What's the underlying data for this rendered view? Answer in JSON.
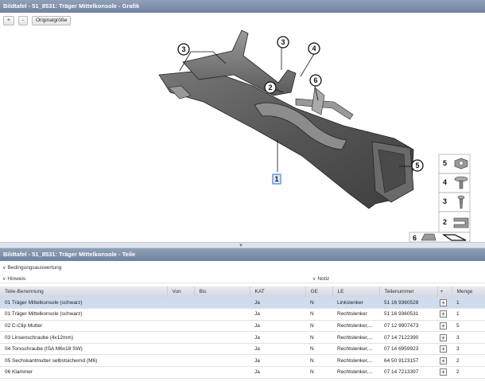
{
  "graphic_panel": {
    "title": "Bildtafel - 51_8531: Träger Mittelkonsole - Grafik",
    "toolbar": {
      "zoom_in": "+",
      "zoom_out": "-",
      "original_size": "Originalgröße"
    },
    "callouts": [
      "1",
      "2",
      "3",
      "3",
      "4",
      "6",
      "5"
    ],
    "legend": [
      "5",
      "4",
      "3",
      "2",
      "6"
    ]
  },
  "parts_panel": {
    "title": "Bildtafel - 51_8531: Träger Mittelkonsole - Teile",
    "filter_condition": "Bedingungsauswertung",
    "filter_hint": "Hinweis",
    "filter_note": "Notiz",
    "columns": [
      "Teile-Benennung",
      "Von",
      "Bis",
      "KAT",
      "GE",
      "LE",
      "Teilenummer",
      "+",
      "Menge"
    ],
    "rows": [
      {
        "name": "01 Träger Mittelkonsole (schwarz)",
        "von": "",
        "bis": "",
        "kat": "Ja",
        "ge": "N",
        "le": "Linkslenker",
        "part": "51 16 9360528",
        "qty": "1",
        "selected": true
      },
      {
        "name": "01 Träger Mittelkonsole (schwarz)",
        "von": "",
        "bis": "",
        "kat": "Ja",
        "ge": "N",
        "le": "Rechtslenker",
        "part": "51 16 9360531",
        "qty": "1",
        "selected": false
      },
      {
        "name": "02 C-Clip Mutter",
        "von": "",
        "bis": "",
        "kat": "Ja",
        "ge": "N",
        "le": "Rechtslenker,...",
        "part": "07 12 9907473",
        "qty": "5",
        "selected": false
      },
      {
        "name": "03 Linsenschraube (4x12mm)",
        "von": "",
        "bis": "",
        "kat": "Ja",
        "ge": "N",
        "le": "Rechtslenker,...",
        "part": "07 14 7122390",
        "qty": "3",
        "selected": false
      },
      {
        "name": "04 Torxschraube (ISA M6x18 SW)",
        "von": "",
        "bis": "",
        "kat": "Ja",
        "ge": "N",
        "le": "Rechtslenker,...",
        "part": "07 14 6959923",
        "qty": "3",
        "selected": false
      },
      {
        "name": "05 Sechskantmutter selbstsichernd (M6)",
        "von": "",
        "bis": "",
        "kat": "Ja",
        "ge": "N",
        "le": "Rechtslenker,...",
        "part": "64 50 9123157",
        "qty": "2",
        "selected": false
      },
      {
        "name": "06 Klammer",
        "von": "",
        "bis": "",
        "kat": "Ja",
        "ge": "N",
        "le": "Rechtslenker,...",
        "part": "07 14 7213397",
        "qty": "2",
        "selected": false
      }
    ],
    "add_symbol": "+"
  }
}
